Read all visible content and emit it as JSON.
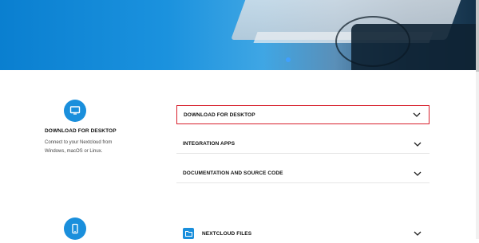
{
  "hero": {
    "image_label": ""
  },
  "feature_desktop": {
    "icon": "monitor-icon",
    "title": "DOWNLOAD FOR DESKTOP",
    "description": "Connect to your Nextcloud from Windows, macOS or Linux."
  },
  "feature_mobile": {
    "icon": "phone-icon"
  },
  "accordion": [
    {
      "label": "DOWNLOAD FOR DESKTOP",
      "active": true
    },
    {
      "label": "INTEGRATION APPS",
      "active": false
    },
    {
      "label": "DOCUMENTATION AND SOURCE CODE",
      "active": false
    }
  ],
  "accordion2": [
    {
      "label": "NEXTCLOUD FILES",
      "icon": "folder-icon"
    }
  ],
  "colors": {
    "accent": "#1a8fdc",
    "focus": "#d71f2c"
  }
}
